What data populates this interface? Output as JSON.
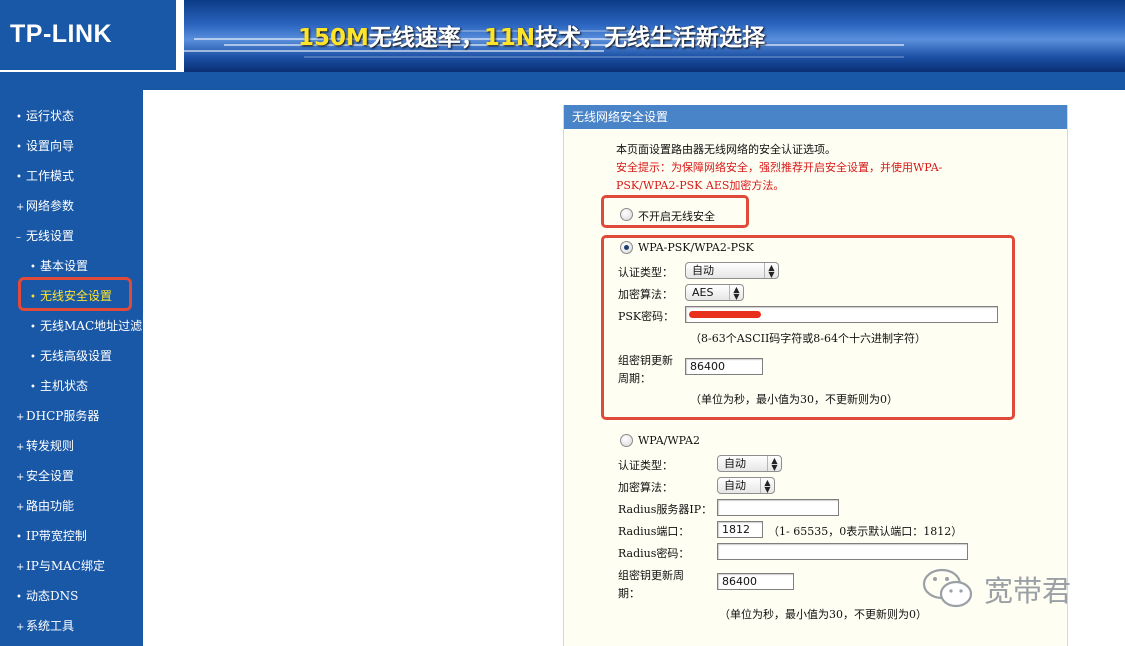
{
  "header": {
    "logo": "TP-LINK",
    "slogan_parts": [
      "150M",
      "无线速率，",
      "11N",
      "技术，无线生活新选择"
    ]
  },
  "nav": {
    "items": [
      {
        "label": "运行状态"
      },
      {
        "label": "设置向导"
      },
      {
        "label": "工作模式"
      },
      {
        "label": "网络参数"
      },
      {
        "label": "无线设置"
      },
      {
        "label": "基本设置"
      },
      {
        "label": "无线安全设置"
      },
      {
        "label": "无线MAC地址过滤"
      },
      {
        "label": "无线高级设置"
      },
      {
        "label": "主机状态"
      },
      {
        "label": "DHCP服务器"
      },
      {
        "label": "转发规则"
      },
      {
        "label": "安全设置"
      },
      {
        "label": "路由功能"
      },
      {
        "label": "IP带宽控制"
      },
      {
        "label": "IP与MAC绑定"
      },
      {
        "label": "动态DNS"
      },
      {
        "label": "系统工具"
      }
    ],
    "active": "无线安全设置"
  },
  "panel": {
    "title": "无线网络安全设置",
    "intro": "本页面设置路由器无线网络的安全认证选项。",
    "warning_line1": "安全提示：为保障网络安全，强烈推荐开启安全设置，并使用WPA-",
    "warning_line2": "PSK/WPA2-PSK AES加密方法。",
    "option_none": "不开启无线安全",
    "psk_section": {
      "title": "WPA-PSK/WPA2-PSK",
      "auth_label": "认证类型：",
      "auth_value": "自动",
      "enc_label": "加密算法：",
      "enc_value": "AES",
      "psk_label": "PSK密码：",
      "psk_hint": "（8-63个ASCII码字符或8-64个十六进制字符）",
      "renew_label_1": "组密钥更新",
      "renew_label_2": "周期：",
      "renew_value": "86400",
      "renew_hint": "（单位为秒，最小值为30，不更新则为0）"
    },
    "wpa_section": {
      "title": "WPA/WPA2",
      "auth_label": "认证类型：",
      "auth_value": "自动",
      "enc_label": "加密算法：",
      "enc_value": "自动",
      "radius_ip_label": "Radius服务器IP：",
      "radius_port_label": "Radius端口：",
      "radius_port_value": "1812",
      "radius_port_hint": "（1-  65535，0表示默认端口：1812）",
      "radius_pwd_label": "Radius密码：",
      "renew_label_1": "组密钥更新周",
      "renew_label_2": "期：",
      "renew_value": "86400",
      "renew_hint": "（单位为秒，最小值为30，不更新则为0）"
    }
  },
  "watermark": {
    "text": "宽带君",
    "icon": "wechat-icon"
  },
  "colors": {
    "nav_bg": "#1958a7",
    "active": "#ffe42a",
    "highlight": "#e04a3a",
    "warning": "#d81818"
  }
}
